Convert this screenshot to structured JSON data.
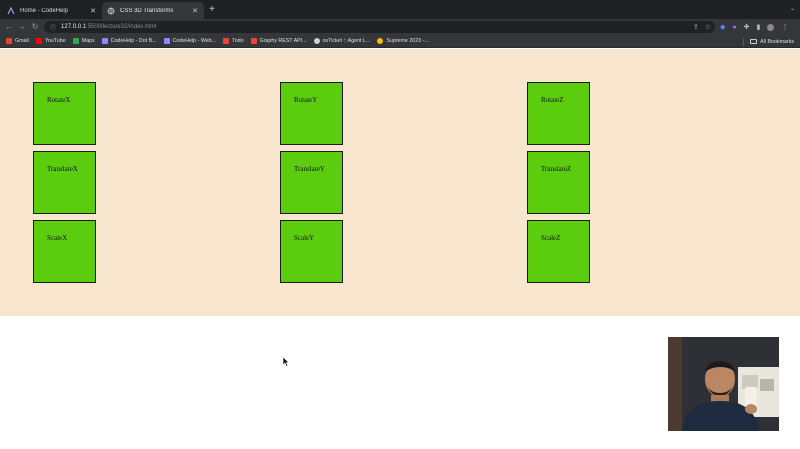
{
  "browser": {
    "tabs": [
      {
        "title": "Home - CodeHelp",
        "favicon": "codehelp-icon",
        "active": false
      },
      {
        "title": "CSS 3D Transforms",
        "favicon": "globe-icon",
        "active": true
      }
    ],
    "url": {
      "host": "127.0.0.1",
      "path": ":5500/lecture32/index.html"
    },
    "bookmarks": [
      {
        "label": "Gmail",
        "color": "#ea4335"
      },
      {
        "label": "YouTube",
        "color": "#ff0000"
      },
      {
        "label": "Maps",
        "color": "#34a853"
      },
      {
        "label": "CodeHelp - Dot B...",
        "color": "#8a8cff"
      },
      {
        "label": "CodeHelp - Web...",
        "color": "#8a8cff"
      },
      {
        "label": "Todo",
        "color": "#e8453c"
      },
      {
        "label": "Graphy REST API...",
        "color": "#e8453c"
      },
      {
        "label": "osTicket :: Agent L...",
        "color": "#cfcfcf"
      },
      {
        "label": "Supreme 2023 -...",
        "color": "#fbbc04"
      }
    ],
    "all_bookmarks_label": "All Bookmarks"
  },
  "page": {
    "background": "#f8e6cf",
    "box_color": "#5ccc0f",
    "columns": [
      {
        "boxes": [
          "RotateX",
          "TranslateX",
          "ScaleX"
        ]
      },
      {
        "boxes": [
          "RotateY",
          "TranslateY",
          "ScaleY"
        ]
      },
      {
        "boxes": [
          "RotateZ",
          "TranslateZ",
          "ScaleZ"
        ]
      }
    ]
  }
}
